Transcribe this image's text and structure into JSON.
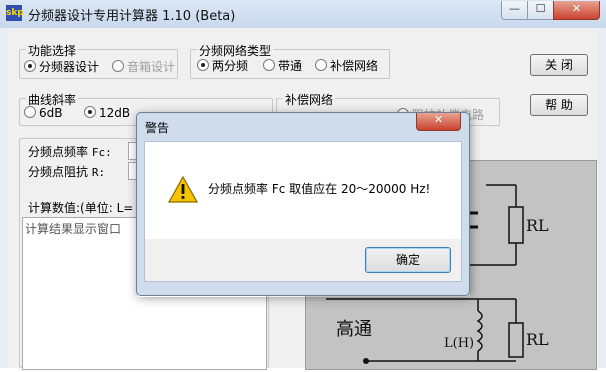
{
  "window": {
    "icon_text": "skp",
    "title": "分频器设计专用计算器 1.10 (Beta)",
    "min_glyph": "—",
    "max_glyph": "☐",
    "close_glyph": "✕"
  },
  "function_group": {
    "label": "功能选择",
    "options": [
      "分频器设计",
      "音箱设计"
    ]
  },
  "network_group": {
    "label": "分频网络类型",
    "options": [
      "两分频",
      "带通",
      "补偿网络"
    ]
  },
  "slope_group": {
    "label": "曲线斜率",
    "options": [
      "6dB",
      "12dB"
    ]
  },
  "comp_group": {
    "label": "补偿网络",
    "options": [
      "阻抗补偿电路"
    ]
  },
  "buttons": {
    "close": "关  闭",
    "help": "帮  助"
  },
  "inputs": {
    "fc_label": "分频点频率",
    "fc_suffix": "Fc:",
    "r_label": "分频点阻抗",
    "r_suffix": "R:"
  },
  "calc": {
    "label": "计算数值:(单位: L=",
    "result_placeholder": "计算结果显示窗口"
  },
  "diagram": {
    "text_highpass": "高通",
    "label_R1": "RL",
    "label_R2": "RL",
    "label_L": "L(H)"
  },
  "dialog": {
    "title": "警告",
    "close_glyph": "✕",
    "message": "分频点频率 Fc 取值应在 20～20000 Hz!",
    "ok": "确定"
  }
}
